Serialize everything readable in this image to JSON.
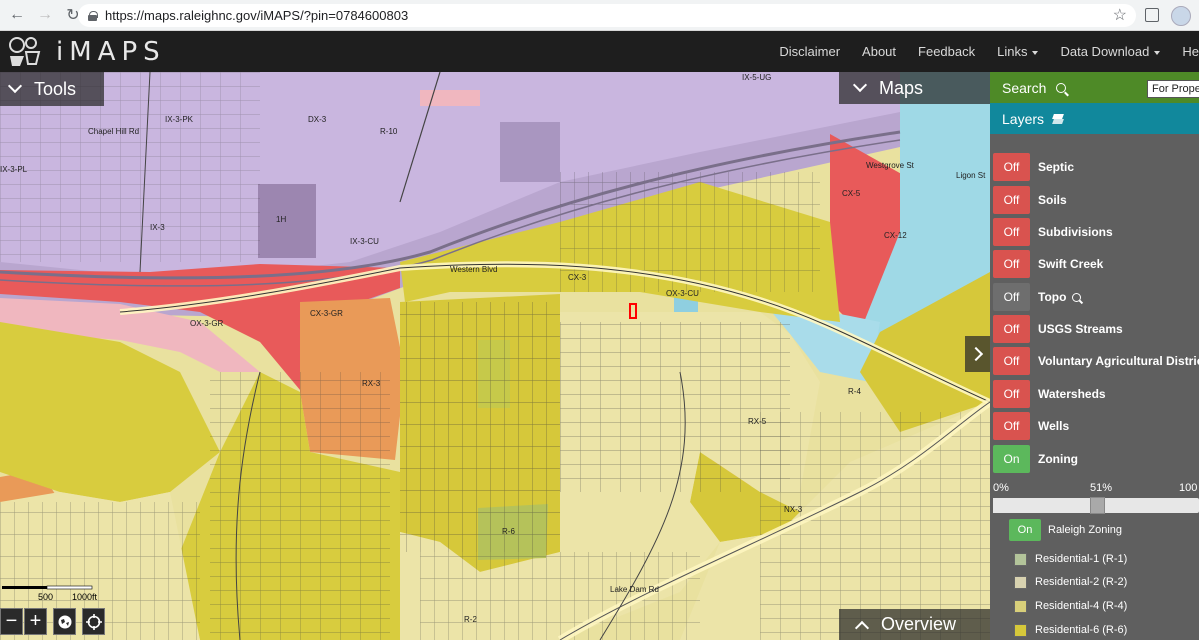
{
  "browser": {
    "url": "https://maps.raleighnc.gov/iMAPS/?pin=0784600803"
  },
  "header": {
    "brand": "iMAPS",
    "nav": [
      "Disclaimer",
      "About",
      "Feedback",
      "Links",
      "Data Download",
      "He"
    ]
  },
  "map": {
    "tools_label": "Tools",
    "maps_label": "Maps",
    "overview_label": "Overview",
    "scale_labels": [
      "500",
      "1000ft"
    ],
    "zone_labels": [
      "IX-3-PK",
      "IX-3",
      "DX-3",
      "R-10",
      "IX-5-UG",
      "IX-3-PL",
      "1H",
      "IX-3-CU",
      "CX-3",
      "CX-12",
      "CX-5",
      "OX-3-GR",
      "RX-3",
      "R-6",
      "R-4",
      "NX-3",
      "RX-5",
      "Ligon St",
      "R-2",
      "CX-3-GR",
      "OX-3-CU",
      "Chapel Hill Rd",
      "Western Blvd",
      "Lake Dam Rd",
      "Westgrove St"
    ]
  },
  "panel": {
    "search_label": "Search",
    "search_placeholder": "For Property",
    "layers_label": "Layers",
    "layers": [
      {
        "name": "Septic",
        "state": "Off"
      },
      {
        "name": "Soils",
        "state": "Off"
      },
      {
        "name": "Subdivisions",
        "state": "Off"
      },
      {
        "name": "Swift Creek",
        "state": "Off"
      },
      {
        "name": "Topo",
        "state": "Off"
      },
      {
        "name": "USGS Streams",
        "state": "Off"
      },
      {
        "name": "Voluntary Agricultural Districts",
        "state": "Off"
      },
      {
        "name": "Watersheds",
        "state": "Off"
      },
      {
        "name": "Wells",
        "state": "Off"
      },
      {
        "name": "Zoning",
        "state": "On"
      }
    ],
    "opacity": {
      "min_label": "0%",
      "value_label": "51%",
      "max_label": "100",
      "value": 51
    },
    "sublayer": {
      "state": "On",
      "name": "Raleigh Zoning"
    },
    "legend": [
      {
        "label": "Residential-1 (R-1)",
        "color": "#b3c49a"
      },
      {
        "label": "Residential-2 (R-2)",
        "color": "#d8d2b0"
      },
      {
        "label": "Residential-4 (R-4)",
        "color": "#d8cf7a"
      },
      {
        "label": "Residential-6 (R-6)",
        "color": "#d6c83a"
      }
    ]
  }
}
